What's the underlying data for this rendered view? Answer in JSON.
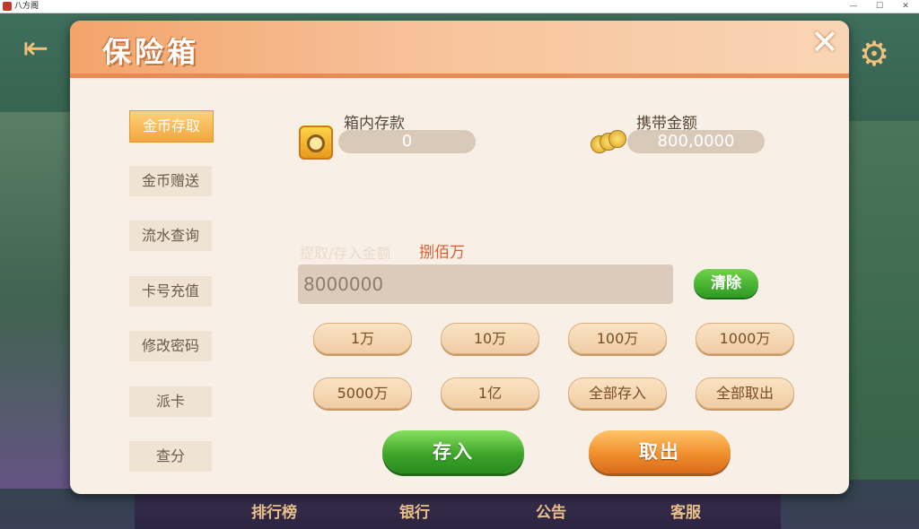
{
  "window": {
    "title": "八方阁",
    "min": "—",
    "max": "☐",
    "close": "✕"
  },
  "background": {
    "bottom_nav": [
      {
        "label": "排行榜"
      },
      {
        "label": "银行"
      },
      {
        "label": "公告"
      },
      {
        "label": "客服"
      }
    ]
  },
  "dialog": {
    "title": "保险箱",
    "close_label": "✕",
    "sidebar": [
      {
        "label": "金币存取",
        "active": true
      },
      {
        "label": "金币赠送",
        "active": false
      },
      {
        "label": "流水查询",
        "active": false
      },
      {
        "label": "卡号充值",
        "active": false
      },
      {
        "label": "修改密码",
        "active": false
      },
      {
        "label": "派卡",
        "active": false
      },
      {
        "label": "查分",
        "active": false
      }
    ],
    "box_deposit": {
      "label": "箱内存款",
      "value": "0"
    },
    "carried": {
      "label": "携带金额",
      "value": "800,0000"
    },
    "amount": {
      "label": "提取/存入金额",
      "words": "捌佰万",
      "value": "8000000"
    },
    "clear_label": "清除",
    "quick_buttons": [
      "1万",
      "10万",
      "100万",
      "1000万",
      "5000万",
      "1亿",
      "全部存入",
      "全部取出"
    ],
    "deposit_label": "存入",
    "withdraw_label": "取出"
  },
  "colors": {
    "accent": "#f3a46a",
    "deposit": "#3ea52a",
    "withdraw": "#f08f2c",
    "amount_words": "#e65a2e"
  }
}
